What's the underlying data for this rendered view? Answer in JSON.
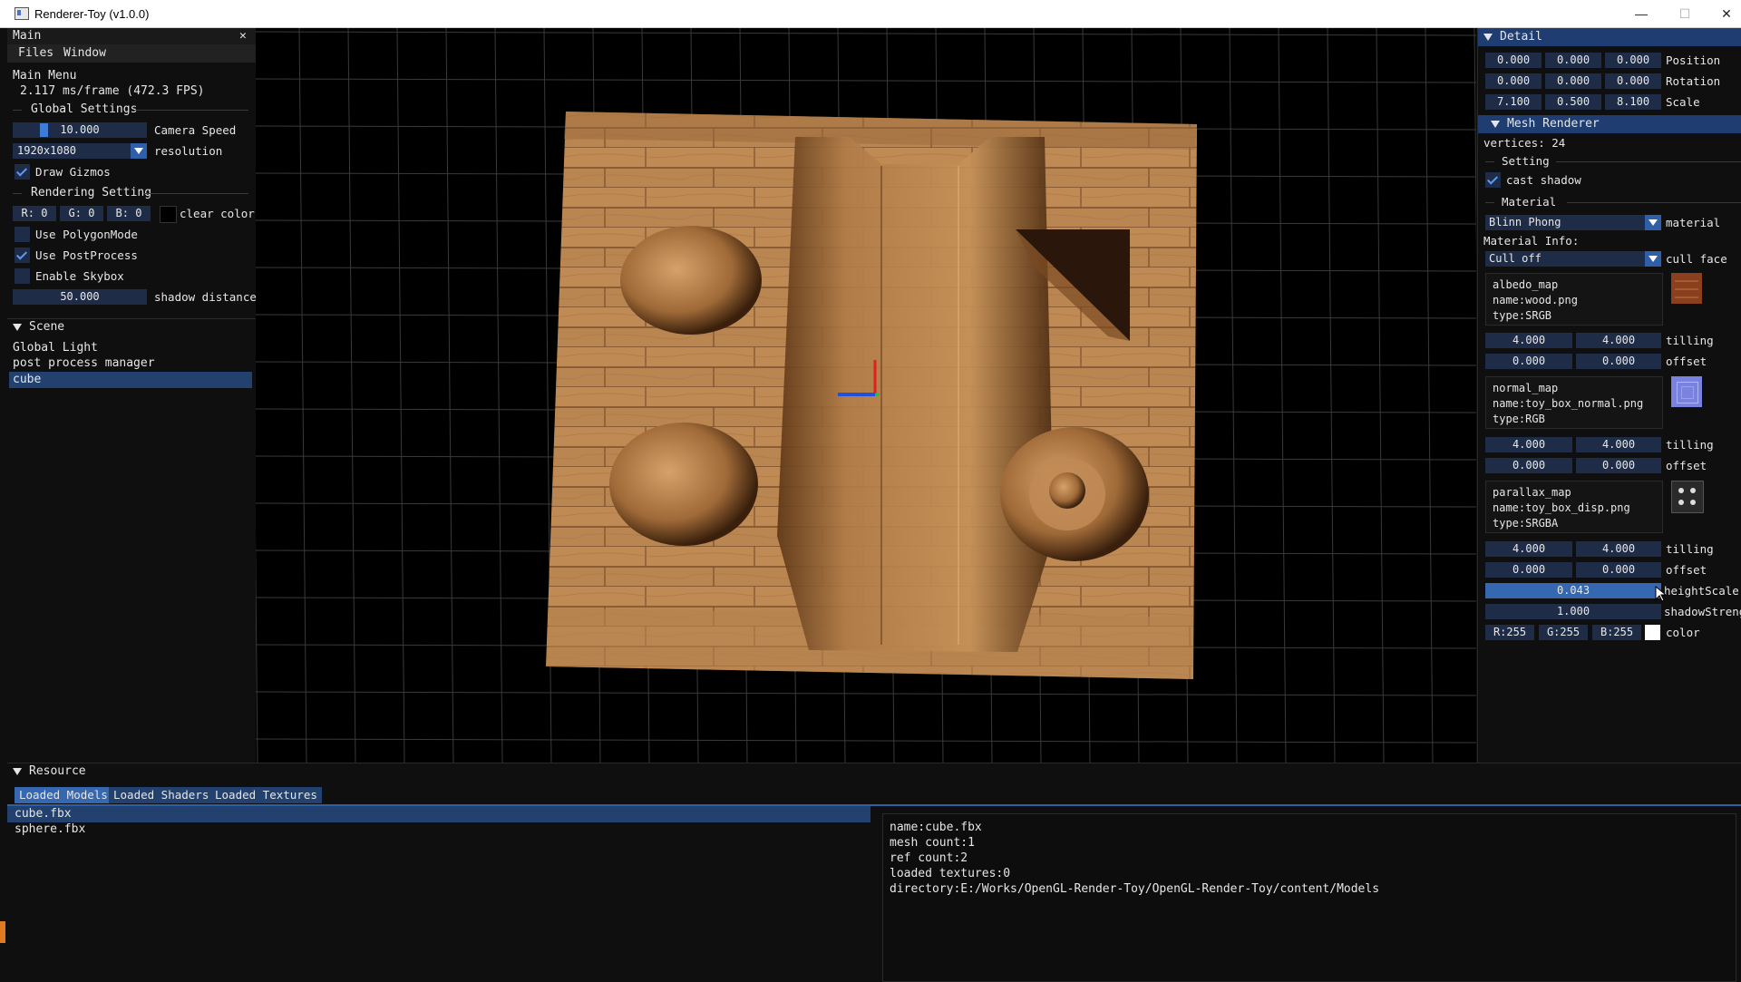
{
  "window": {
    "title": "Renderer-Toy (v1.0.0)",
    "minimize": "—",
    "maximize": "☐",
    "close": "✕"
  },
  "main_panel": {
    "title": "Main",
    "close_glyph": "✕",
    "menu": [
      "Files",
      "Window"
    ],
    "section_title": "Main Menu",
    "fps_text": "2.117 ms/frame (472.3 FPS)",
    "global_settings": {
      "header": "Global Settings",
      "camera_speed_value": "10.000",
      "camera_speed_label": "Camera Speed",
      "camera_speed_fraction": 0.2,
      "resolution_value": "1920x1080",
      "resolution_label": "resolution",
      "draw_gizmos_label": "Draw Gizmos",
      "draw_gizmos_checked": true
    },
    "rendering_setting": {
      "header": "Rendering Setting",
      "r": "R: 0",
      "g": "G: 0",
      "b": "B: 0",
      "clear_color_label": "clear color",
      "use_polygon_mode": "Use PolygonMode",
      "use_polygon_mode_checked": false,
      "use_postprocess": "Use PostProcess",
      "use_postprocess_checked": true,
      "enable_skybox": "Enable Skybox",
      "enable_skybox_checked": false,
      "shadow_distance_value": "50.000",
      "shadow_distance_label": "shadow distance"
    }
  },
  "scene_panel": {
    "title": "Scene",
    "items": [
      "Global Light",
      "post process manager",
      "cube"
    ],
    "selected": "cube"
  },
  "detail_panel": {
    "title": "Detail",
    "transform": [
      {
        "label": "Position",
        "values": [
          "0.000",
          "0.000",
          "0.000"
        ]
      },
      {
        "label": "Rotation",
        "values": [
          "0.000",
          "0.000",
          "0.000"
        ]
      },
      {
        "label": "Scale",
        "values": [
          "7.100",
          "0.500",
          "8.100"
        ]
      }
    ],
    "mesh_renderer": {
      "header": "Mesh Renderer",
      "vertices": "vertices: 24",
      "setting_header": "Setting",
      "cast_shadow": "cast shadow",
      "cast_shadow_checked": true,
      "material_header": "Material",
      "material_value": "Blinn Phong",
      "material_label": "material",
      "material_info": "Material Info:",
      "cull_value": "Cull off",
      "cull_label": "cull face"
    },
    "textures": [
      {
        "line1": "albedo_map",
        "line2": "name:wood.png",
        "line3": "type:SRGB",
        "tilling": [
          "4.000",
          "4.000"
        ],
        "offset": [
          "0.000",
          "0.000"
        ],
        "thumb_icon": "wood-texture-icon"
      },
      {
        "line1": "normal_map",
        "line2": "name:toy_box_normal.png",
        "line3": "type:RGB",
        "tilling": [
          "4.000",
          "4.000"
        ],
        "offset": [
          "0.000",
          "0.000"
        ],
        "thumb_icon": "normal-texture-icon"
      },
      {
        "line1": "parallax_map",
        "line2": "name:toy_box_disp.png",
        "line3": "type:SRGBA",
        "tilling": [
          "4.000",
          "4.000"
        ],
        "offset": [
          "0.000",
          "0.000"
        ],
        "thumb_icon": "displacement-texture-icon"
      }
    ],
    "tilling_label": "tilling",
    "offset_label": "offset",
    "height_scale_value": "0.043",
    "height_scale_label": "heightScale",
    "shadow_strength_value": "1.000",
    "shadow_strength_label": "shadowStreng",
    "color": {
      "r": "R:255",
      "g": "G:255",
      "b": "B:255",
      "label": "color"
    }
  },
  "resource_panel": {
    "title": "Resource",
    "tabs": [
      "Loaded Models",
      "Loaded Shaders",
      "Loaded Textures"
    ],
    "active_tab": "Loaded Models",
    "models": [
      "cube.fbx",
      "sphere.fbx"
    ],
    "selected_model": "cube.fbx",
    "info": [
      "name:cube.fbx",
      "mesh count:1",
      "ref count:2",
      "loaded textures:0",
      "directory:E:/Works/OpenGL-Render-Toy/OpenGL-Render-Toy/content/Models"
    ]
  },
  "colors": {
    "accent": "#3568b0",
    "header_bg": "#1f3d70",
    "field_bg": "#1e2c48",
    "checkmark": "#5a9cf8",
    "gizmo_x": "#2050e0",
    "gizmo_y": "#e02020",
    "gizmo_z": "#20c040"
  }
}
